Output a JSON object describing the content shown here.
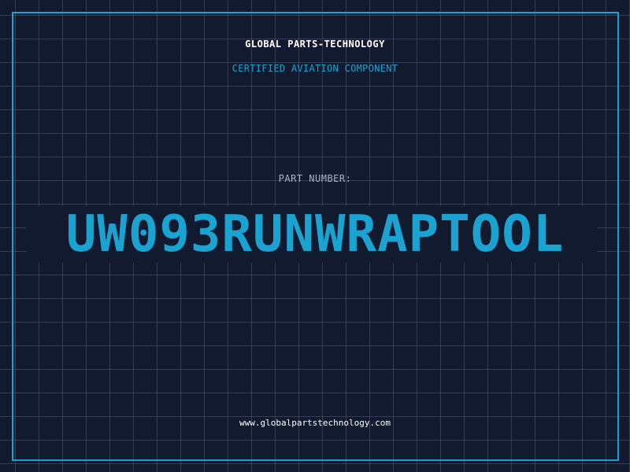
{
  "company": "GLOBAL PARTS-TECHNOLOGY",
  "subtitle": "CERTIFIED AVIATION COMPONENT",
  "part_number_label": "PART NUMBER:",
  "part_number": "UW093RUNWRAPTOOL",
  "website": "www.globalpartstechnology.com",
  "colors": {
    "background": "#111a2e",
    "accent": "#1aa3d1",
    "grid": "#1e6e96",
    "text": "#ffffff",
    "muted": "#a9b4c6"
  }
}
